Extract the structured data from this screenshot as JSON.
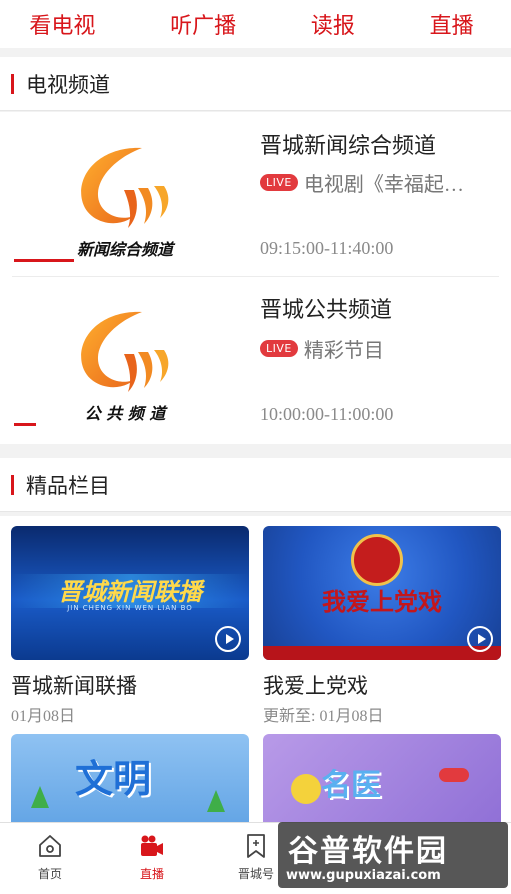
{
  "topnav": {
    "tabs": [
      "看电视",
      "听广播",
      "读报",
      "直播"
    ]
  },
  "tv_section": {
    "title": "电视频道"
  },
  "channels": [
    {
      "logo_text": "新闻综合频道",
      "name": "晋城新闻综合频道",
      "live_badge": "LIVE",
      "program": "电视剧《幸福起…",
      "time": "09:15:00-11:40:00"
    },
    {
      "logo_text": "公 共 频 道",
      "name": "晋城公共频道",
      "live_badge": "LIVE",
      "program": "精彩节目",
      "time": "10:00:00-11:00:00"
    }
  ],
  "featured_section": {
    "title": "精品栏目"
  },
  "programs": [
    {
      "title": "晋城新闻联播",
      "date": "01月08日",
      "thumb_text": "晋城新闻联播",
      "thumb_sub": "JIN CHENG XIN WEN LIAN BO"
    },
    {
      "title": "我爱上党戏",
      "date": "更新至:  01月08日",
      "thumb_text": "我爱上党戏"
    },
    {
      "thumb_text": "文明"
    },
    {
      "thumb_text": "名医"
    }
  ],
  "bottomnav": {
    "items": [
      "首页",
      "直播",
      "晋城号"
    ]
  },
  "watermark": {
    "text": "谷普软件园",
    "url": "www.gupuxiazai.com"
  },
  "colors": {
    "accent": "#d8161b",
    "live": "#e23a3e"
  }
}
